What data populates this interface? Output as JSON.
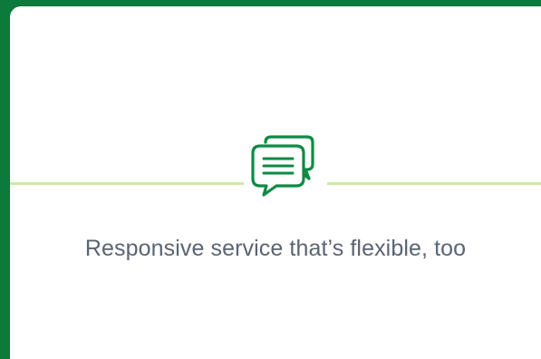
{
  "feature": {
    "icon": "chat-bubbles-icon",
    "text": "Responsive service that’s flexible, too"
  },
  "colors": {
    "border_green": "#0b7a3b",
    "icon_green": "#0e8a44",
    "divider_line": "#cfe9a6",
    "text": "#5b6472",
    "card_bg": "#ffffff"
  }
}
